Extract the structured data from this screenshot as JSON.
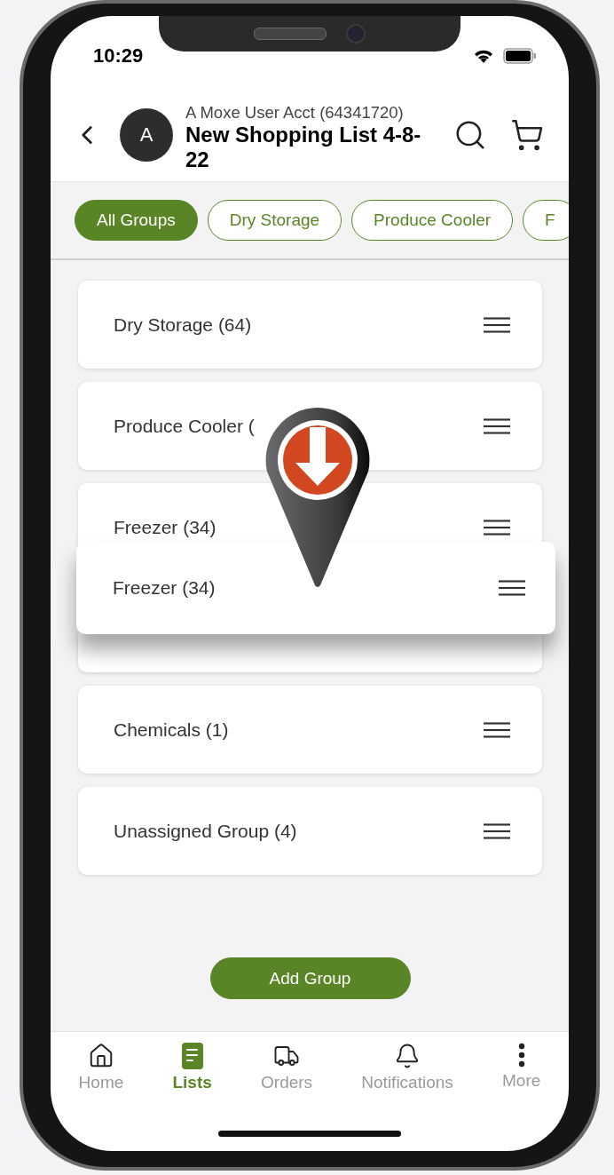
{
  "status_bar": {
    "time": "10:29"
  },
  "header": {
    "avatar": "A",
    "account": "A Moxe User Acct (64341720)",
    "title": "New Shopping List 4-8-22"
  },
  "filters": [
    {
      "label": "All Groups",
      "selected": true
    },
    {
      "label": "Dry Storage",
      "selected": false
    },
    {
      "label": "Produce Cooler",
      "selected": false
    },
    {
      "label": "F",
      "selected": false
    }
  ],
  "groups": [
    {
      "kind": "card",
      "label": "Dry Storage (64)"
    },
    {
      "kind": "card",
      "label": "Produce Cooler ("
    },
    {
      "kind": "card",
      "label": "Freezer (34)"
    },
    {
      "kind": "hidden"
    },
    {
      "kind": "card",
      "label": "Chemicals (1)"
    },
    {
      "kind": "card",
      "label": "Unassigned Group (4)"
    }
  ],
  "dragged_group": {
    "label": "Freezer (34)"
  },
  "add_button": "Add Group",
  "tabs": [
    {
      "kind": "home",
      "label": "Home",
      "selected": false
    },
    {
      "kind": "lists",
      "label": "Lists",
      "selected": true
    },
    {
      "kind": "orders",
      "label": "Orders",
      "selected": false
    },
    {
      "kind": "notifications",
      "label": "Notifications",
      "selected": false
    },
    {
      "kind": "more",
      "label": "More",
      "selected": false
    }
  ]
}
